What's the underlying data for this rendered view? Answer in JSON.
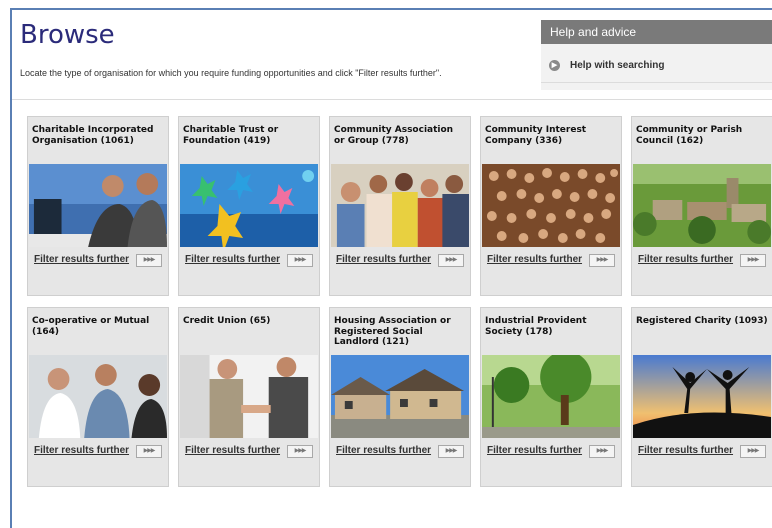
{
  "header": {
    "title": "Browse",
    "description": "Locate the type of organisation for which you require funding opportunities and click \"Filter results further\"."
  },
  "help": {
    "heading": "Help and advice",
    "link_label": "Help with searching"
  },
  "cards": [
    {
      "title": "Charitable Incorporated Organisation (1061)",
      "link": "Filter results further",
      "image_icon": "office-meeting-photo"
    },
    {
      "title": "Charitable Trust or Foundation (419)",
      "link": "Filter results further",
      "image_icon": "paper-figures-photo"
    },
    {
      "title": "Community Association or Group (778)",
      "link": "Filter results further",
      "image_icon": "group-people-photo"
    },
    {
      "title": "Community Interest Company (336)",
      "link": "Filter results further",
      "image_icon": "crowd-photo"
    },
    {
      "title": "Community or Parish Council (162)",
      "link": "Filter results further",
      "image_icon": "village-photo"
    },
    {
      "title": "Co-operative or Mutual (164)",
      "link": "Filter results further",
      "image_icon": "business-team-photo"
    },
    {
      "title": "Credit Union (65)",
      "link": "Filter results further",
      "image_icon": "handshake-photo"
    },
    {
      "title": "Housing Association or Registered Social Landlord (121)",
      "link": "Filter results further",
      "image_icon": "houses-photo"
    },
    {
      "title": "Industrial Provident Society (178)",
      "link": "Filter results further",
      "image_icon": "park-tree-photo"
    },
    {
      "title": "Registered Charity (1093)",
      "link": "Filter results further",
      "image_icon": "silhouettes-photo"
    }
  ],
  "button_glyph": "▶▶▶"
}
